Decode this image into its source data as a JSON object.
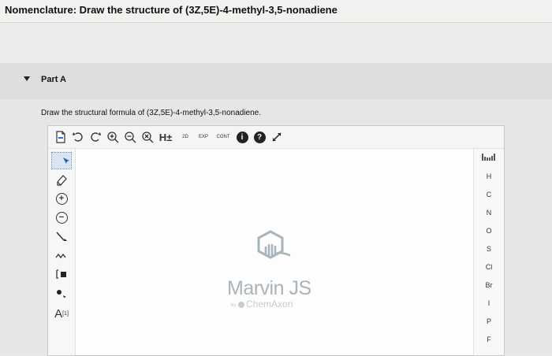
{
  "header": {
    "title": "Nomenclature: Draw the structure of (3Z,5E)-4-methyl-3,5-nonadiene"
  },
  "part": {
    "label": "Part A"
  },
  "question": {
    "instructions": "Draw the structural formula of (3Z,5E)-4-methyl-3,5-nonadiene."
  },
  "editor": {
    "toolbar": {
      "hydrogen_label": "H±",
      "two_d_label": "2D",
      "exp_label": "EXP",
      "cont_label": "CONT",
      "info_label": "i",
      "help_label": "?"
    },
    "left_tools": {
      "plus_label": "+",
      "minus_label": "−",
      "atom_map_label": "A",
      "atom_map_index": "[1]"
    },
    "elements": [
      "H",
      "C",
      "N",
      "O",
      "S",
      "Cl",
      "Br",
      "I",
      "P",
      "F"
    ],
    "watermark": {
      "product": "Marvin JS",
      "by": "by",
      "company": "ChemAxon"
    }
  },
  "colors": {
    "header_bg": "#f1f2f0",
    "editor_bg": "#fdfdfd",
    "accent_blue": "#2a6fd6"
  }
}
